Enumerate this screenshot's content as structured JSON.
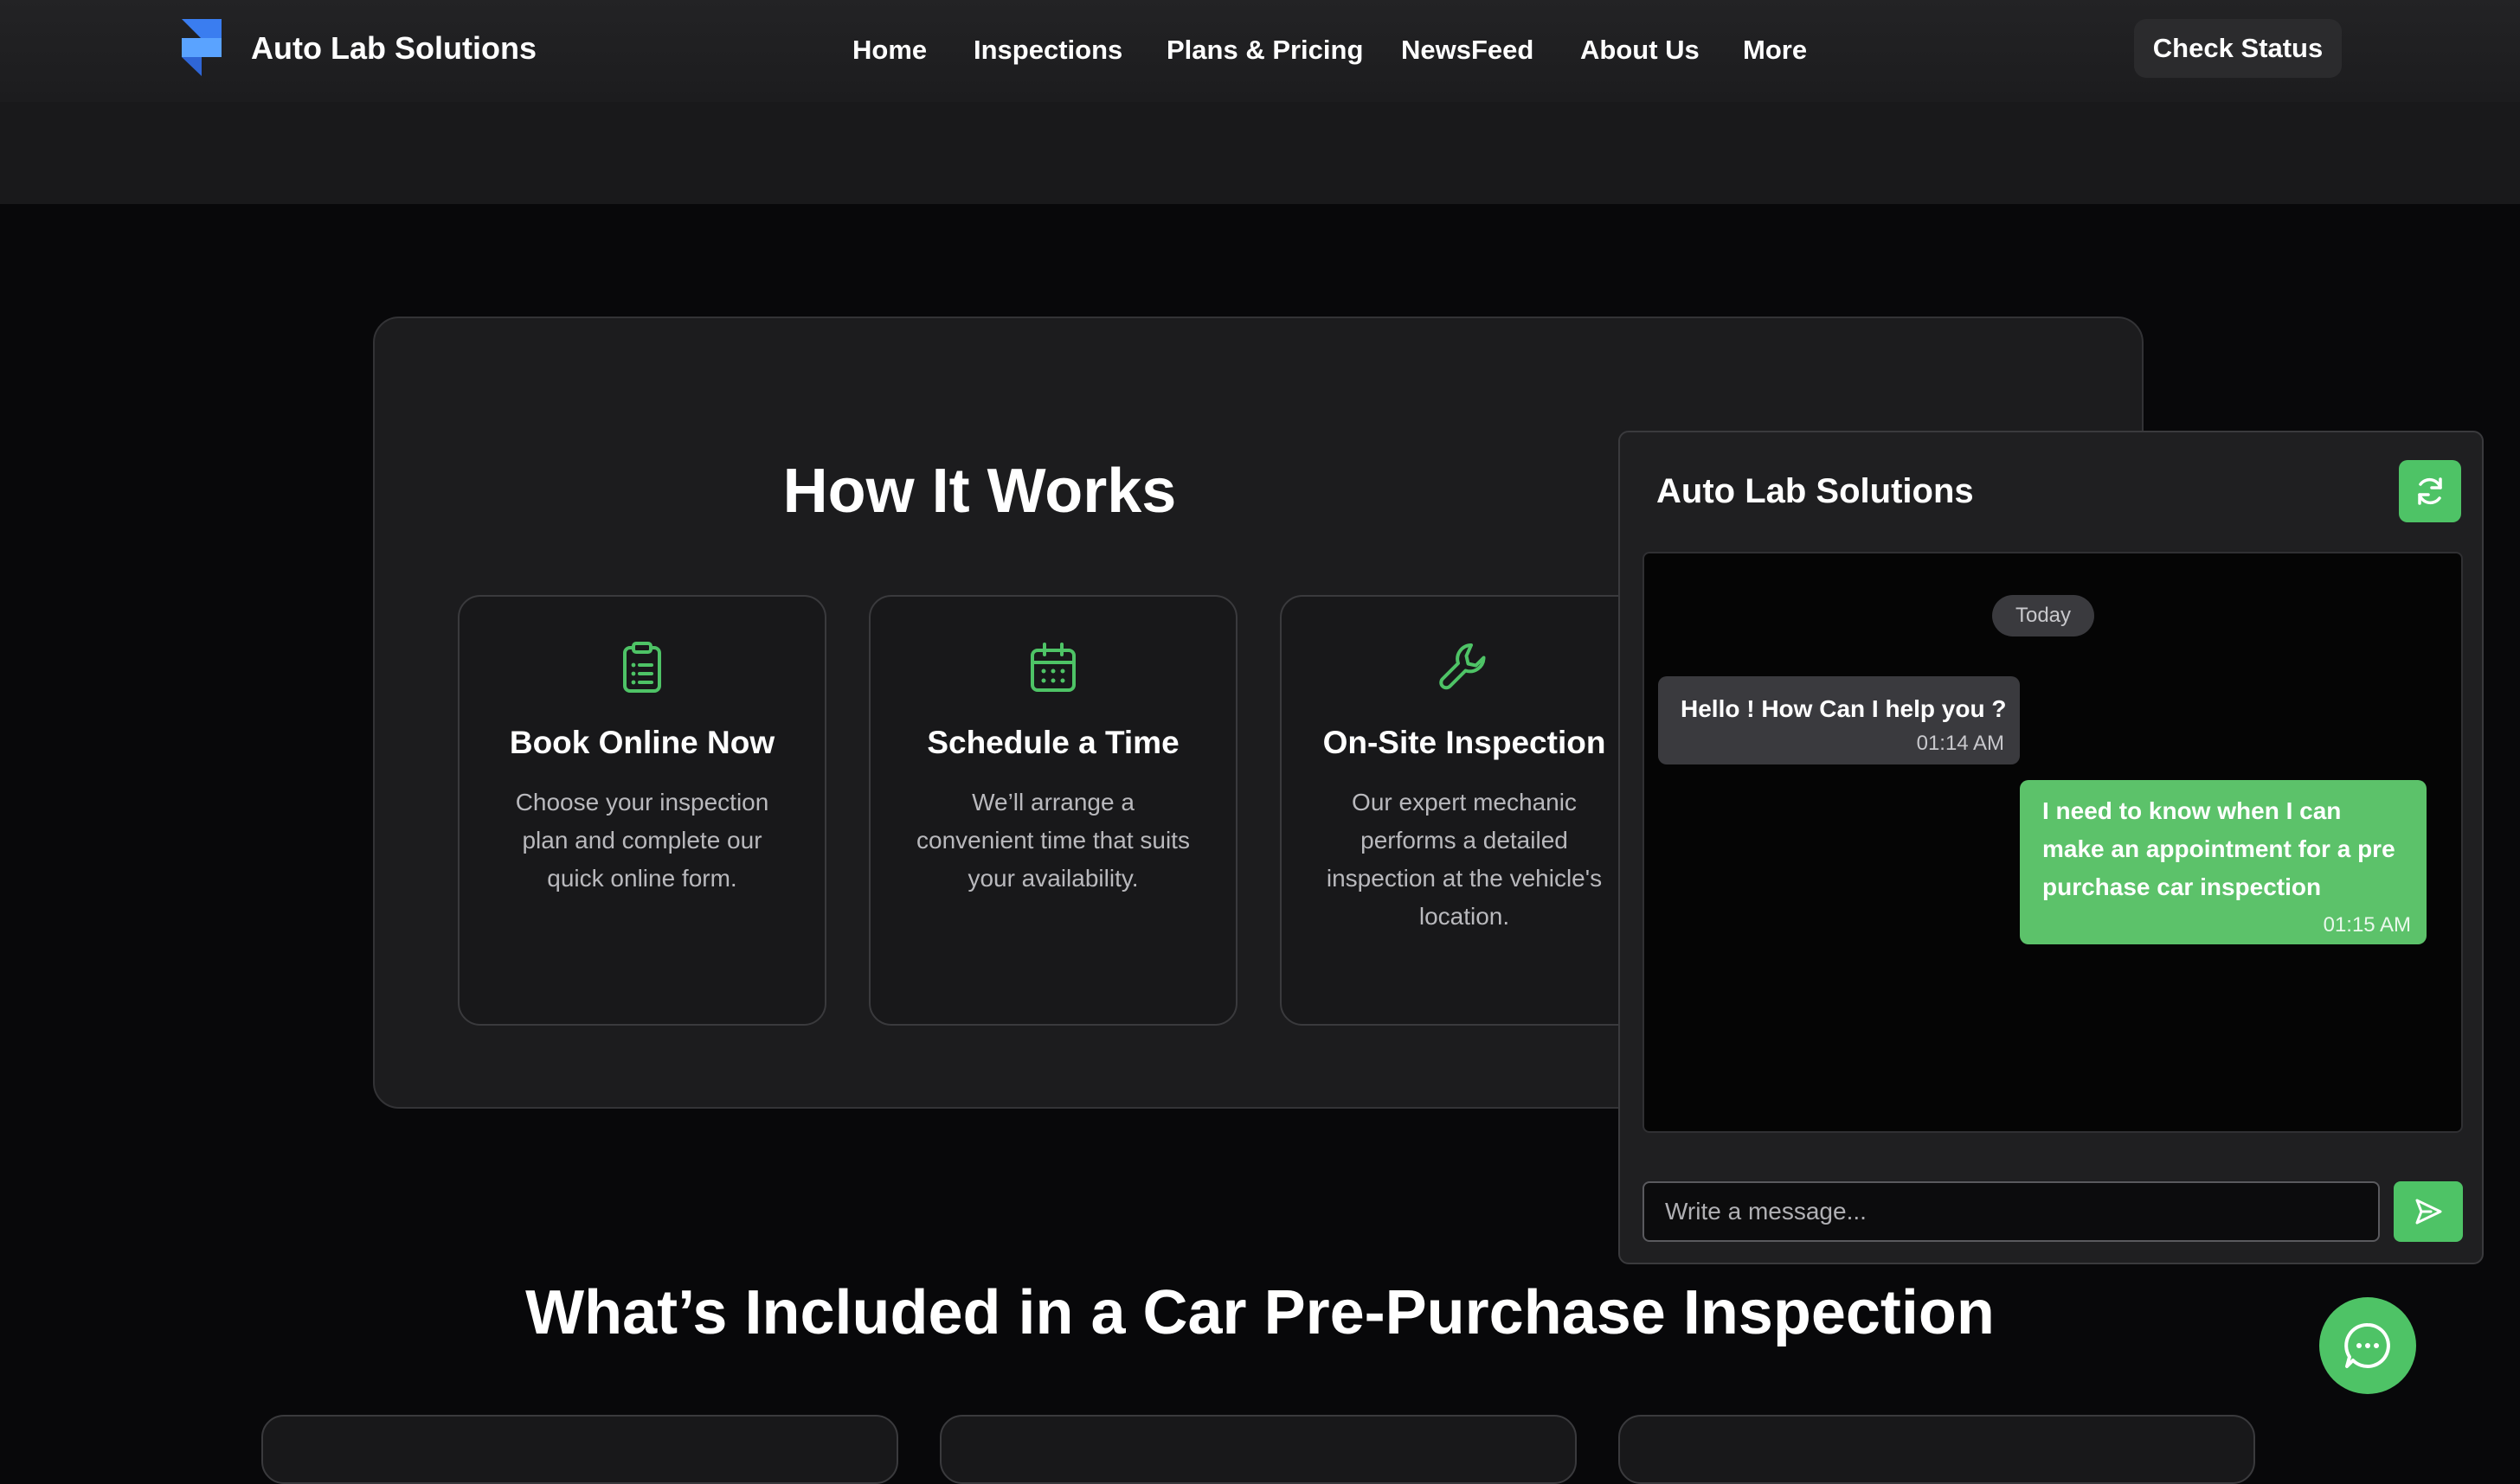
{
  "header": {
    "brand": "Auto Lab Solutions",
    "nav": [
      "Home",
      "Inspections",
      "Plans & Pricing",
      "NewsFeed",
      "About Us",
      "More"
    ],
    "cta": "Check Status"
  },
  "how_it_works": {
    "title": "How It Works",
    "steps": [
      {
        "icon": "clipboard-icon",
        "title": "Book Online Now",
        "desc": "Choose your inspection plan and complete our quick online form."
      },
      {
        "icon": "calendar-icon",
        "title": "Schedule a Time",
        "desc": "We’ll arrange a convenient time that suits your availability."
      },
      {
        "icon": "wrench-icon",
        "title": "On-Site Inspection",
        "desc": "Our expert mechanic performs a detailed inspection at the vehicle's location."
      }
    ]
  },
  "included": {
    "title": "What’s Included in a Car Pre-Purchase Inspection"
  },
  "chat": {
    "title": "Auto Lab Solutions",
    "date_label": "Today",
    "messages": [
      {
        "from": "bot",
        "text": "Hello ! How Can I help you ?",
        "time": "01:14 AM"
      },
      {
        "from": "user",
        "text": "I need to know when I can make an appointment for a pre purchase car inspection",
        "time": "01:15 AM"
      }
    ],
    "input_placeholder": "Write a message...",
    "input_value": ""
  },
  "colors": {
    "accent": "#4ec366",
    "background": "#08080a",
    "panel": "#1c1c1e"
  }
}
